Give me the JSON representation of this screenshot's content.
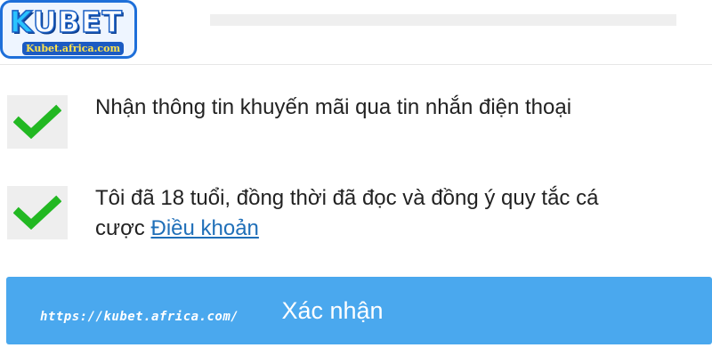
{
  "logo": {
    "word_k": "K",
    "word_rest": "UBET",
    "domain": "Kubet.africa.com"
  },
  "options": [
    {
      "text": "Nhận thông tin khuyến mãi qua tin nhắn điện thoại",
      "checked": true
    },
    {
      "text": "Tôi đã 18 tuổi, đồng thời đã đọc và đồng ý quy tắc cá cược",
      "link_text": "Điều khoản",
      "checked": true
    }
  ],
  "confirm_button": {
    "label": "Xác nhận"
  },
  "watermark": {
    "url": "https://kubet.africa.com/"
  },
  "colors": {
    "accent": "#4aa8ee",
    "check": "#22b822",
    "link": "#1f6fb8",
    "logo_border": "#1e6fd9"
  },
  "icons": {
    "checkmark": "checkmark-icon"
  }
}
